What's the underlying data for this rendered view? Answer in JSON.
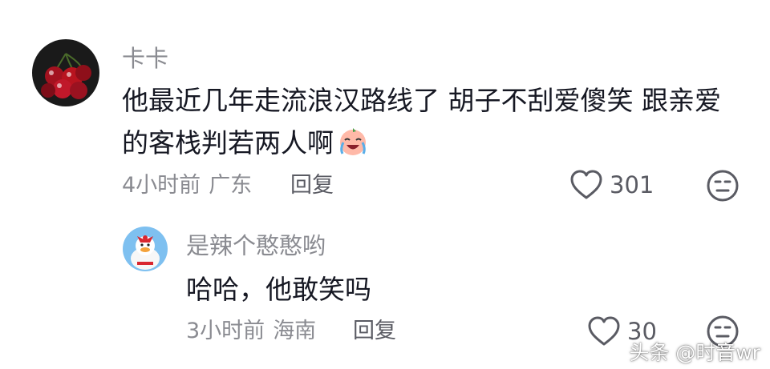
{
  "comments": [
    {
      "username": "卡卡",
      "text_line1": "他最近几年走流浪汉路线了 胡子不刮爱傻笑 跟亲爱",
      "text_line2": "的客栈判若两人啊",
      "inline_emoji": "laugh-cry-emoji",
      "time": "4小时前",
      "location": "广东",
      "reply_label": "回复",
      "likes": "301",
      "avatar_icon": "cherries-avatar"
    }
  ],
  "replies": [
    {
      "username": "是辣个憨憨哟",
      "text": "哈哈，他敢笑吗",
      "time": "3小时前",
      "location": "海南",
      "reply_label": "回复",
      "likes": "30",
      "avatar_icon": "duck-avatar"
    }
  ],
  "watermark": "头条 @时音wr",
  "icons": {
    "like": "heart-outline-icon",
    "dislike": "meh-face-icon"
  },
  "colors": {
    "text": "#161823",
    "secondary": "#8a8b91",
    "action": "#5a5b63"
  }
}
